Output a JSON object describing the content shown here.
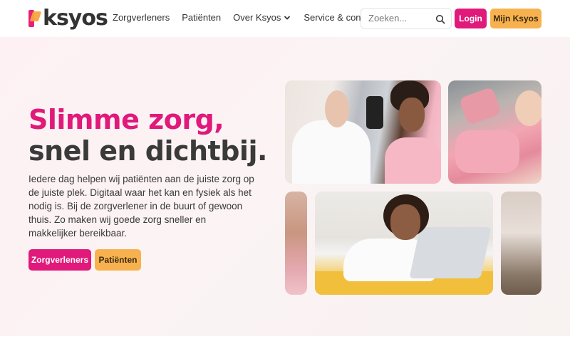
{
  "header": {
    "logo_text": "ksyos",
    "nav": [
      {
        "label": "Zorgverleners"
      },
      {
        "label": "Patiënten"
      },
      {
        "label": "Over Ksyos"
      },
      {
        "label": "Service & contact"
      }
    ],
    "search_placeholder": "Zoeken...",
    "login_label": "Login",
    "mijn_label": "Mijn Ksyos"
  },
  "hero": {
    "title_line1": "Slimme zorg,",
    "title_line2": "snel en dichtbij.",
    "text": "Iedere dag helpen wij patiënten aan de juiste zorg op de juiste plek. Digitaal waar het kan en fysiek als het nodig is. Bij de zorgverlener in de buurt of gewoon thuis. Zo maken wij goede zorg sneller en makkelijker bereikbaar.",
    "btn_zorgverleners": "Zorgverleners",
    "btn_patienten": "Patiënten"
  },
  "colors": {
    "brand_pink": "#e0197a",
    "brand_orange": "#f7b24f",
    "text_dark": "#3a3a3a"
  },
  "icons": {
    "search": "search-icon",
    "chevron": "chevron-down-icon"
  }
}
